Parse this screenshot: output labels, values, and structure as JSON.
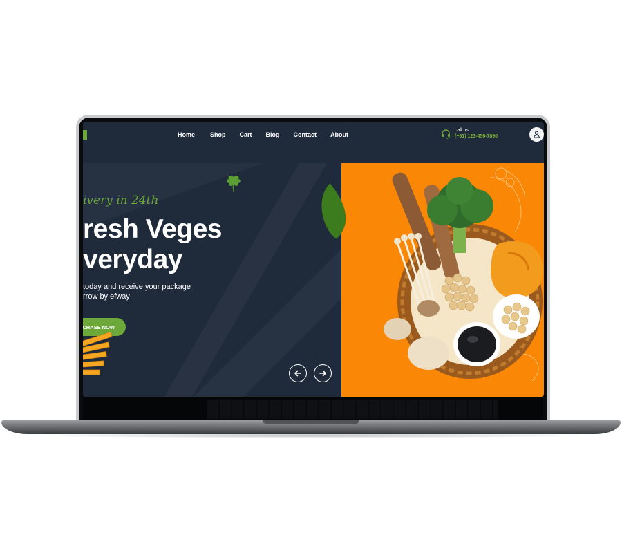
{
  "nav": {
    "items": [
      {
        "label": "Home"
      },
      {
        "label": "Shop"
      },
      {
        "label": "Cart"
      },
      {
        "label": "Blog"
      },
      {
        "label": "Contact"
      },
      {
        "label": "About"
      }
    ]
  },
  "contact": {
    "label": "call us",
    "phone": "(+91) 123-456-7890"
  },
  "hero": {
    "tagline": "ivery in 24th",
    "headline_line1": "resh Veges",
    "headline_line2": "veryday",
    "subtext_line1": "today and receive your package",
    "subtext_line2": "rrow by efway",
    "cta_label": "RCHASE NOW"
  },
  "colors": {
    "background": "#1f2a3b",
    "accent_green": "#6da83a",
    "orange_panel": "#fa8705"
  },
  "icons": {
    "contact": "headset-icon",
    "user": "user-icon",
    "prev": "arrow-left-icon",
    "next": "arrow-right-icon"
  }
}
